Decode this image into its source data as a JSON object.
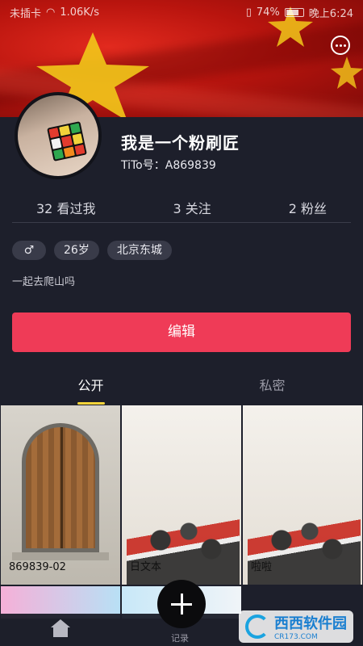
{
  "status_bar": {
    "carrier": "未插卡",
    "speed": "1.06K/s",
    "battery": "74%",
    "time": "晚上6:24"
  },
  "profile": {
    "username": "我是一个粉刷匠",
    "user_id": "TiTo号：A869839",
    "bio": "一起去爬山吗",
    "tags": [
      "♂",
      "26岁",
      "北京东城"
    ]
  },
  "stats": {
    "viewed": "32 看过我",
    "following": "3 关注",
    "followers": "2 粉丝"
  },
  "actions": {
    "edit_label": "编辑"
  },
  "tabs": {
    "public": "公开",
    "private": "私密"
  },
  "posts": [
    {
      "caption": "869839-02"
    },
    {
      "caption": "日文本"
    },
    {
      "caption": "啦啦"
    }
  ],
  "bottom_nav": {
    "record_label": "记录"
  },
  "watermark": {
    "brand": "西西软件园",
    "sub": "CR173.COM"
  },
  "colors": {
    "background": "#1d1f2b",
    "accent": "#ef3b57",
    "tab_indicator": "#f5d33a"
  }
}
